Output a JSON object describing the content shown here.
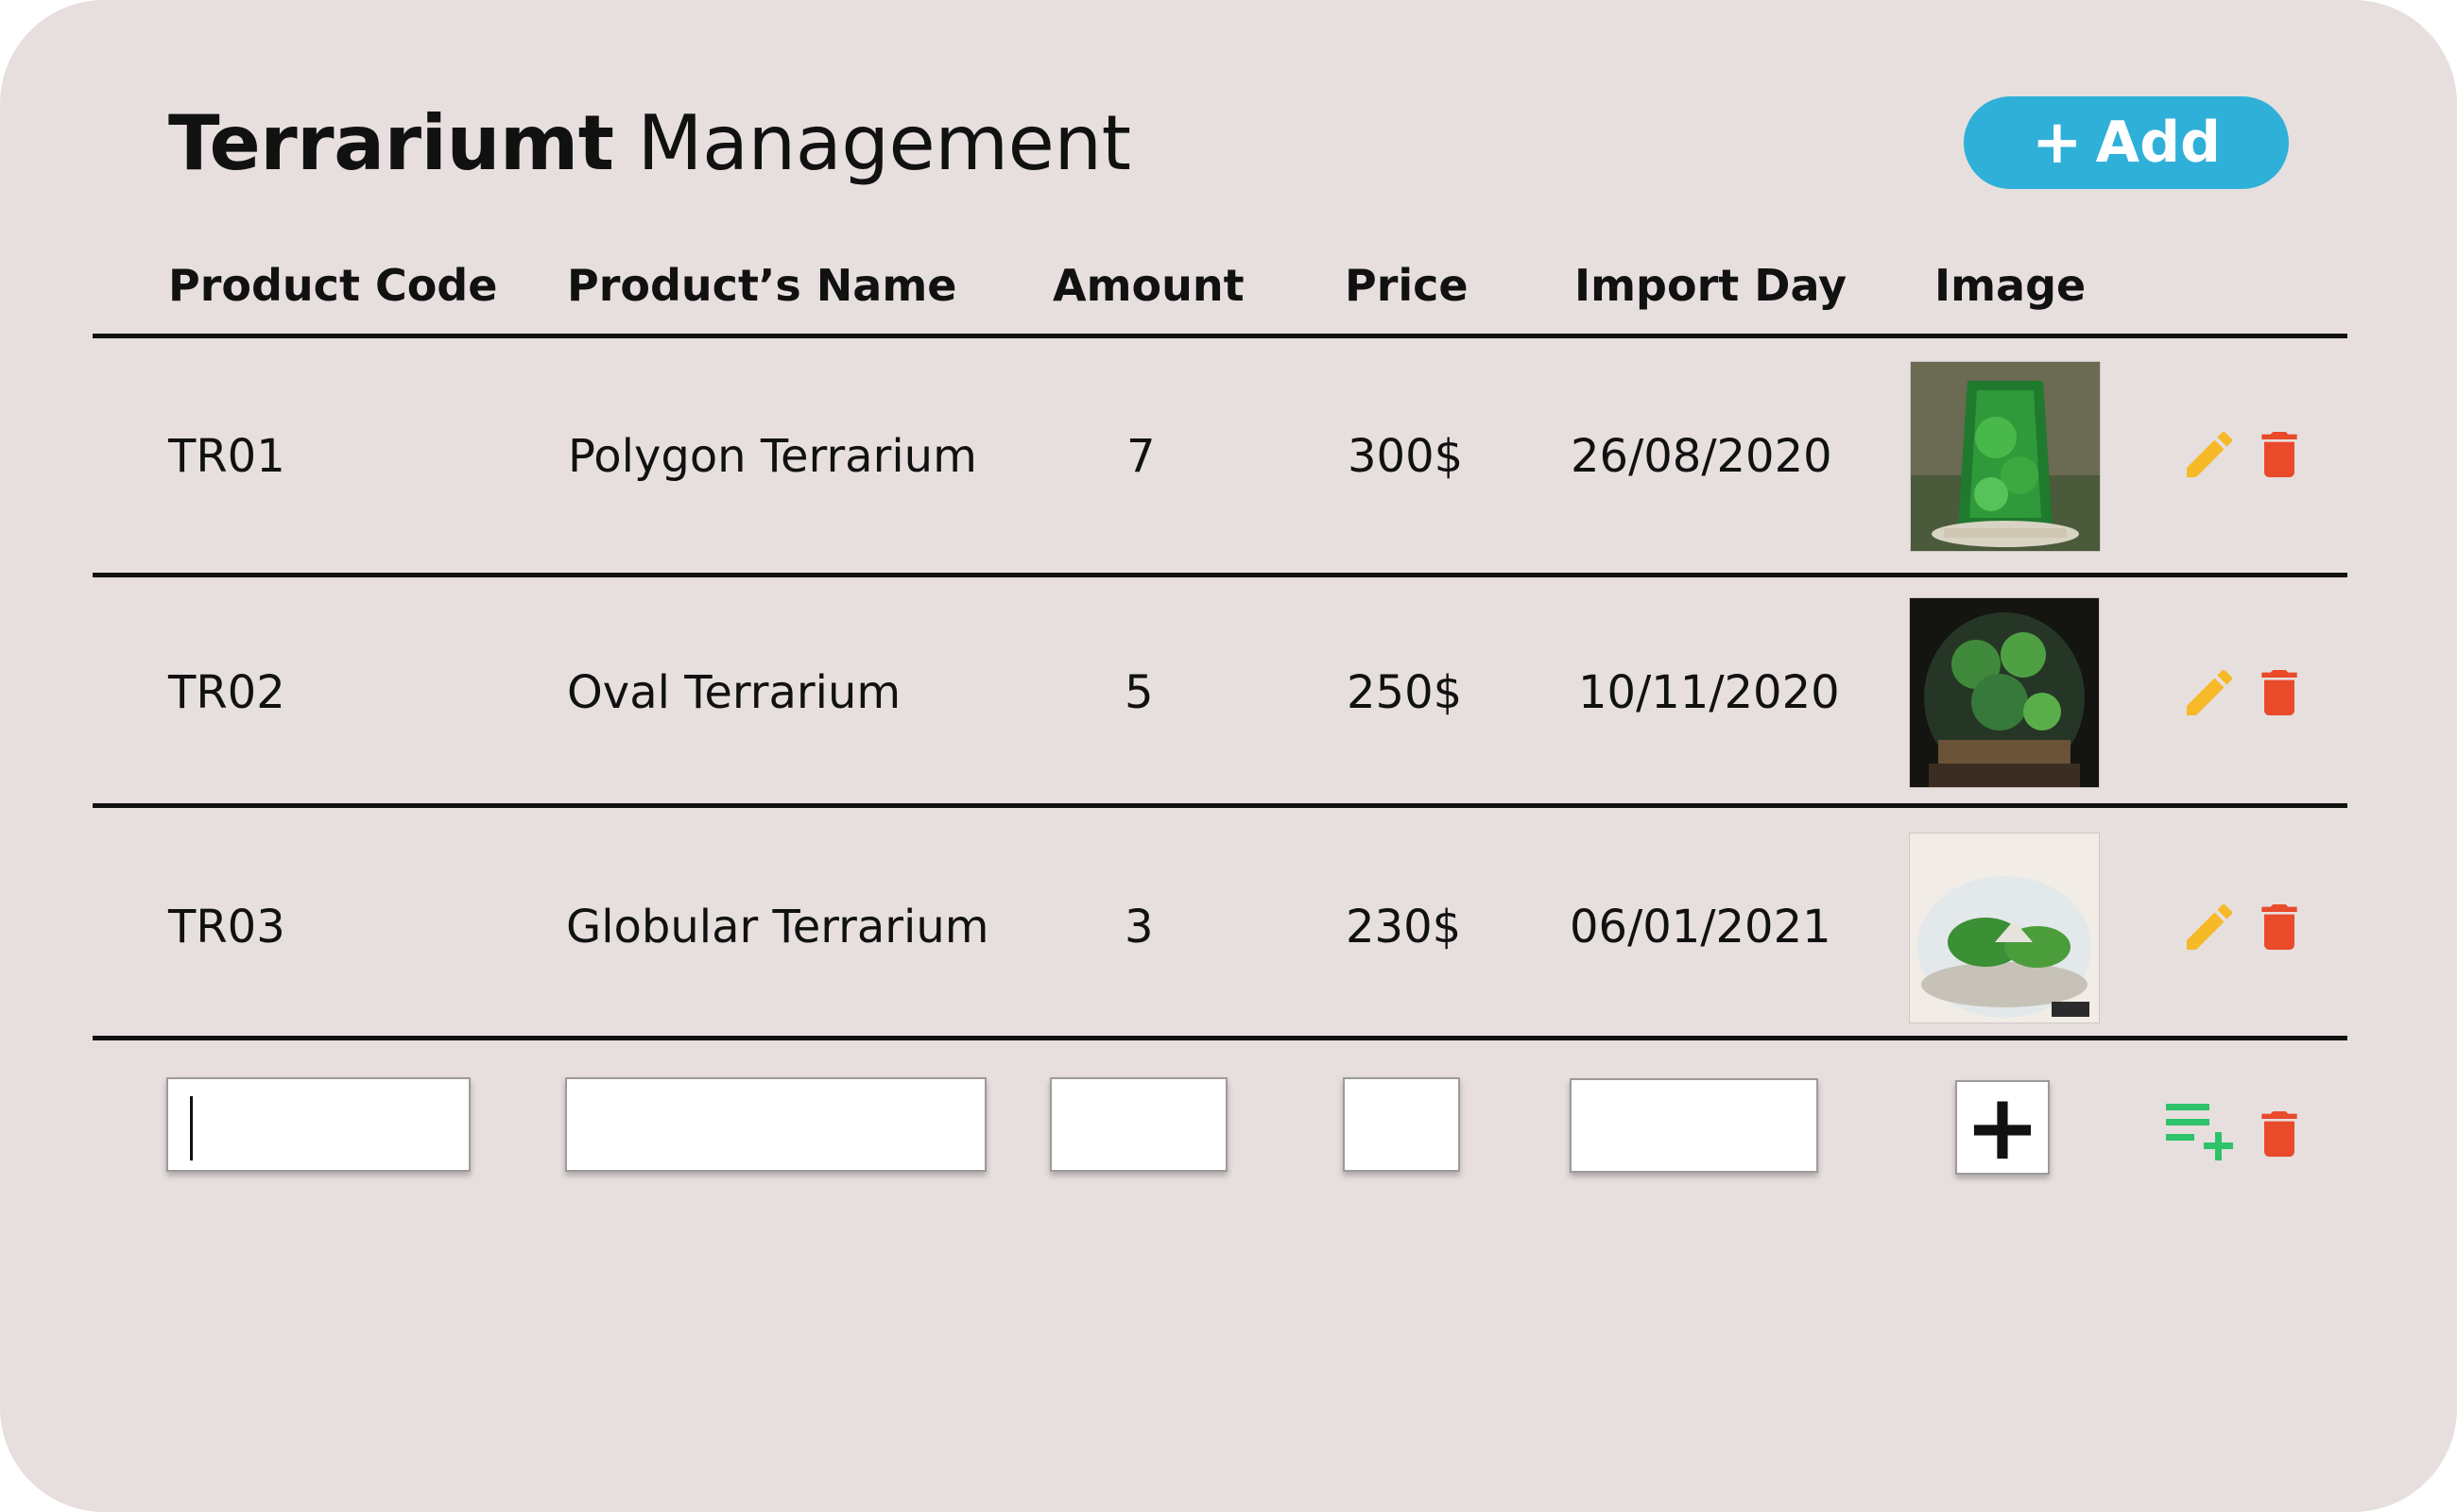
{
  "title": {
    "bold": "Terrariumt",
    "light": "Management"
  },
  "add_button": {
    "plus": "+",
    "label": "Add"
  },
  "columns": [
    "Product Code",
    "Product’s Name",
    "Amount",
    "Price",
    "Import Day",
    "Image"
  ],
  "rows": [
    {
      "code": "TR01",
      "name": "Polygon Terrarium",
      "amount": "7",
      "price": "300$",
      "import_day": "26/08/2020",
      "image": "polygon-terrarium-photo"
    },
    {
      "code": "TR02",
      "name": "Oval Terrarium",
      "amount": "5",
      "price": "250$",
      "import_day": "10/11/2020",
      "image": "oval-terrarium-photo"
    },
    {
      "code": "TR03",
      "name": "Globular Terrarium",
      "amount": "3",
      "price": "230$",
      "import_day": "06/01/2021",
      "image": "globular-terrarium-photo"
    }
  ],
  "new_row": {
    "code_value": "",
    "name_value": "",
    "amount_value": "",
    "price_value": "",
    "import_day_value": "",
    "upload_label": "+"
  },
  "icons": {
    "edit": "pencil-icon",
    "delete": "trash-icon",
    "add_row": "playlist-add-icon",
    "upload": "plus-icon"
  },
  "colors": {
    "background": "#e6dfde",
    "accent": "#2fb0d9",
    "edit": "#f6b928",
    "delete": "#e94a2a",
    "add_row": "#2ec26a"
  }
}
